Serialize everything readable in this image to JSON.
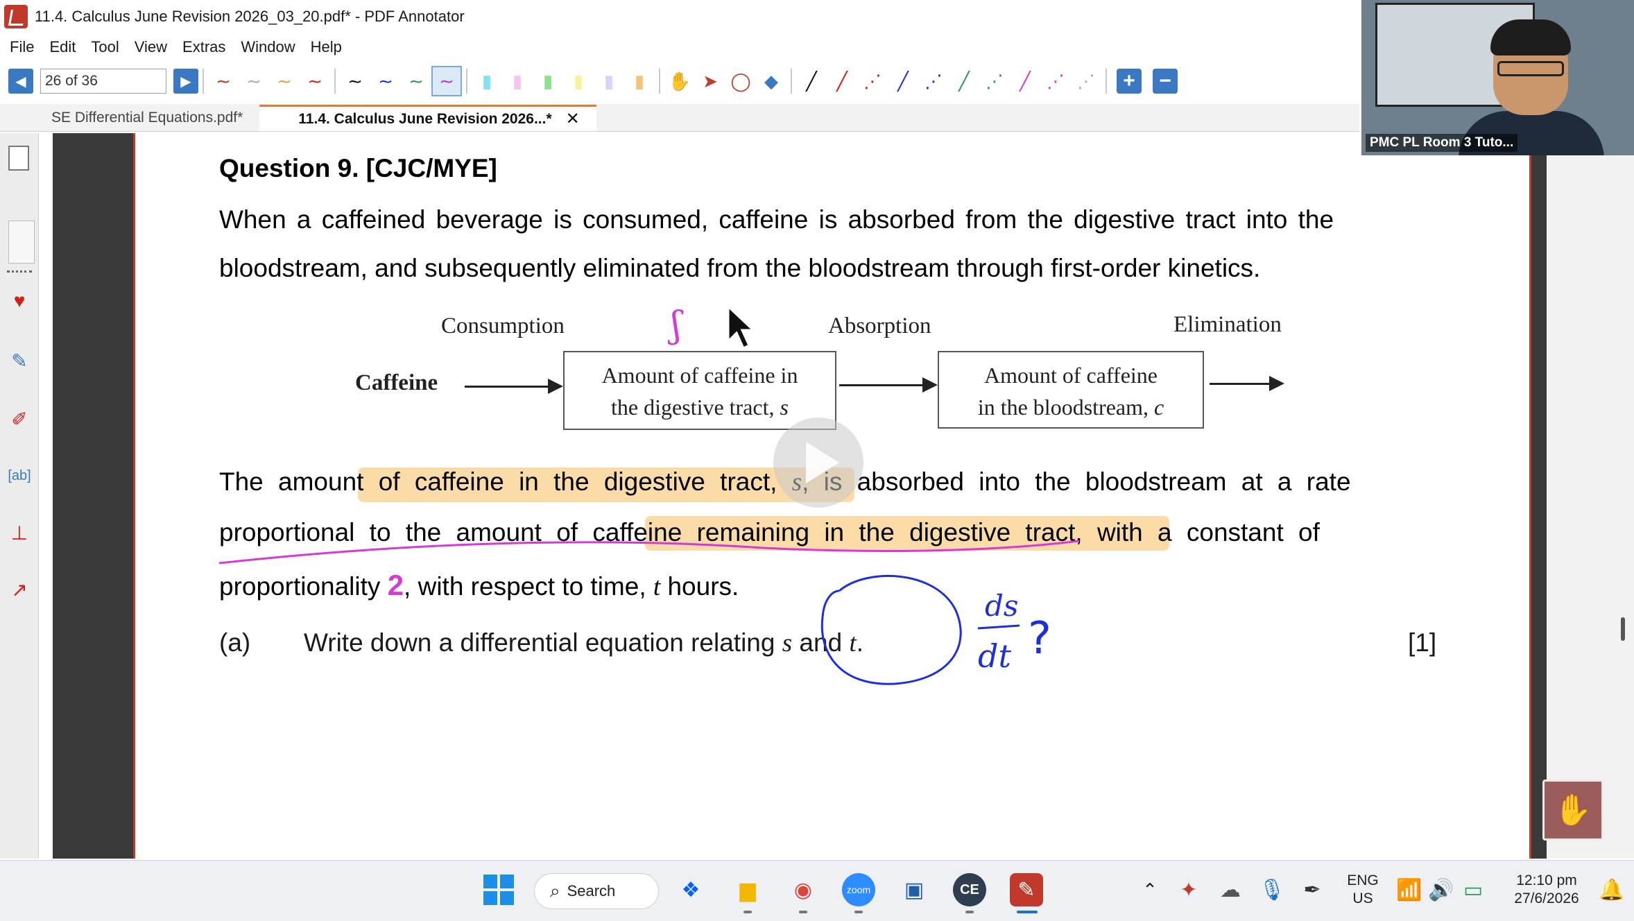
{
  "window": {
    "title": "11.4. Calculus June Revision 2026_03_20.pdf* - PDF Annotator"
  },
  "menu": [
    "File",
    "Edit",
    "Tool",
    "View",
    "Extras",
    "Window",
    "Help"
  ],
  "toolbar": {
    "page_indicator": "26 of 36"
  },
  "tabs": [
    {
      "label": "SE Differential Equations.pdf*"
    },
    {
      "label": "11.4. Calculus June Revision 2026...*"
    }
  ],
  "document": {
    "question_title": "Question 9. [CJC/MYE]",
    "para1_line1": "When a caffeined beverage is consumed, caffeine is absorbed from the digestive tract into the",
    "para1_line2": "bloodstream, and subsequently eliminated from the bloodstream through first-order kinetics.",
    "diagram": {
      "consumption": "Consumption",
      "absorption": "Absorption",
      "elimination": "Elimination",
      "caffeine": "Caffeine",
      "box1_line1": "Amount of caffeine in",
      "box1_line2": "the digestive tract,",
      "box1_var": "s",
      "box2_line1": "Amount of caffeine",
      "box2_line2": "in the bloodstream,",
      "box2_var": "c"
    },
    "para2_line1_a": "The amount of caffeine in the digestive tract,",
    "para2_line1_var": "s",
    "para2_line1_b": ", is absorbed into the bloodstream at a rate",
    "para2_line2": "proportional to the amount of caffeine remaining in the digestive tract, with a constant of",
    "para2_line3_a": "proportionality",
    "para2_line3_k": "2",
    "para2_line3_b": ", with respect to time,",
    "para2_line3_var": "t",
    "para2_line3_c": "hours.",
    "part_a_label": "(a)",
    "part_a_text": "Write down a differential equation relating",
    "part_a_s": "s",
    "part_a_and": "and",
    "part_a_t": "t",
    "part_a_end": ".",
    "part_a_marks": "[1]"
  },
  "ink": {
    "s_mark": "ʃ",
    "ds": "ds",
    "dt": "dt",
    "question": "?"
  },
  "video": {
    "participant_name": "PMC PL Room 3 Tuto..."
  },
  "taskbar": {
    "search_label": "Search",
    "lang_line1": "ENG",
    "lang_line2": "US",
    "time": "12:10 pm",
    "date": "27/6/2026"
  },
  "colors": {
    "accent_red": "#c0392b",
    "nav_blue": "#3a78c2",
    "highlight": "#f7b850",
    "ink_magenta": "#d63ad6",
    "ink_blue": "#1f2fd6"
  }
}
